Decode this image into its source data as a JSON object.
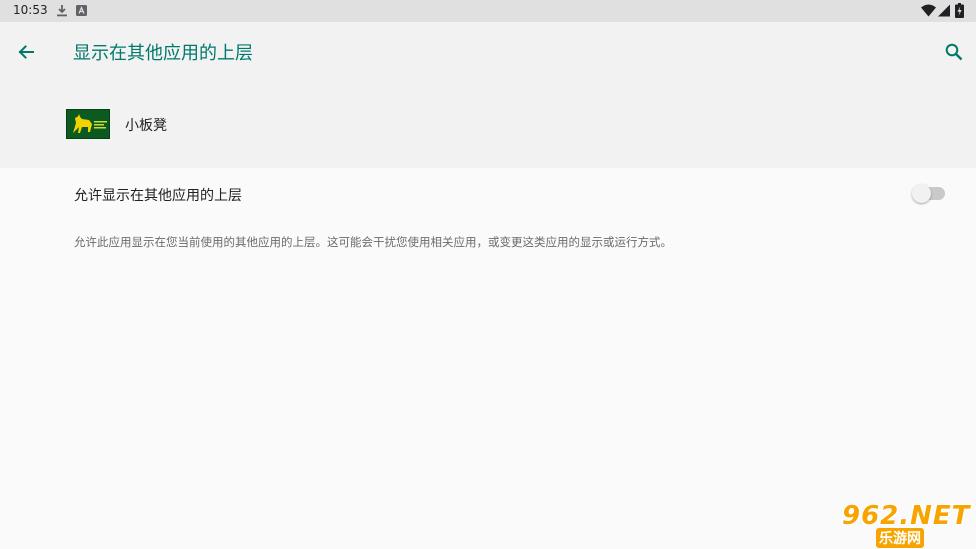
{
  "status_bar": {
    "time": "10:53",
    "icons": [
      "download-icon",
      "app-notification-icon",
      "wifi-icon",
      "signal-icon",
      "battery-icon"
    ]
  },
  "header": {
    "title": "显示在其他应用的上层",
    "back_icon": "arrow-back-icon",
    "search_icon": "search-icon",
    "accent_color": "#00796b"
  },
  "app": {
    "name": "小板凳",
    "icon": "app-logo-icon"
  },
  "setting": {
    "title": "允许显示在其他应用的上层",
    "enabled": false,
    "summary": "允许此应用显示在您当前使用的其他应用的上层。这可能会干扰您使用相关应用，或变更这类应用的显示或运行方式。"
  },
  "watermark": {
    "main": "962.NET",
    "sub": "乐游网"
  }
}
